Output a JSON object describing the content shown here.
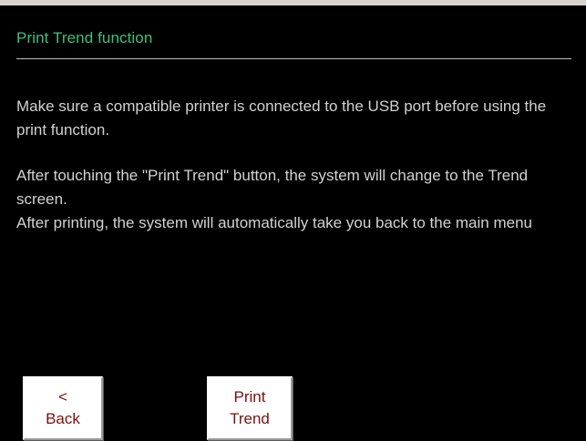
{
  "header": {
    "title": "Print Trend function"
  },
  "body": {
    "paragraph1": "Make sure a compatible printer is connected to the USB port before using the print function.",
    "paragraph2_line1": "After touching the \"Print Trend\" button, the system will change to the Trend screen.",
    "paragraph2_line2": "After printing, the system will automatically take you back to the main menu"
  },
  "buttons": {
    "back": {
      "line1": "<",
      "line2": "Back"
    },
    "print_trend": {
      "line1": "Print",
      "line2": "Trend"
    }
  },
  "colors": {
    "background": "#000000",
    "title": "#3ec07a",
    "body_text": "#d2d2d2",
    "button_face": "#ffffff",
    "button_text": "#7a1010"
  }
}
